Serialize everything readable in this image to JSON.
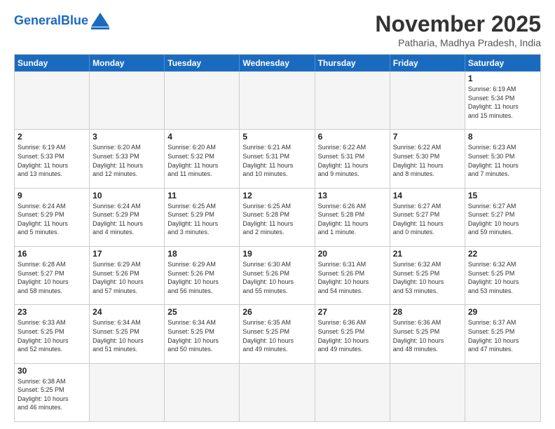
{
  "header": {
    "logo_general": "General",
    "logo_blue": "Blue",
    "month_title": "November 2025",
    "subtitle": "Patharia, Madhya Pradesh, India"
  },
  "day_names": [
    "Sunday",
    "Monday",
    "Tuesday",
    "Wednesday",
    "Thursday",
    "Friday",
    "Saturday"
  ],
  "weeks": [
    [
      {
        "date": "",
        "empty": true
      },
      {
        "date": "",
        "empty": true
      },
      {
        "date": "",
        "empty": true
      },
      {
        "date": "",
        "empty": true
      },
      {
        "date": "",
        "empty": true
      },
      {
        "date": "",
        "empty": true
      },
      {
        "date": "1",
        "info": "Sunrise: 6:19 AM\nSunset: 5:34 PM\nDaylight: 11 hours\nand 15 minutes."
      }
    ],
    [
      {
        "date": "2",
        "info": "Sunrise: 6:19 AM\nSunset: 5:33 PM\nDaylight: 11 hours\nand 13 minutes."
      },
      {
        "date": "3",
        "info": "Sunrise: 6:20 AM\nSunset: 5:33 PM\nDaylight: 11 hours\nand 12 minutes."
      },
      {
        "date": "4",
        "info": "Sunrise: 6:20 AM\nSunset: 5:32 PM\nDaylight: 11 hours\nand 11 minutes."
      },
      {
        "date": "5",
        "info": "Sunrise: 6:21 AM\nSunset: 5:31 PM\nDaylight: 11 hours\nand 10 minutes."
      },
      {
        "date": "6",
        "info": "Sunrise: 6:22 AM\nSunset: 5:31 PM\nDaylight: 11 hours\nand 9 minutes."
      },
      {
        "date": "7",
        "info": "Sunrise: 6:22 AM\nSunset: 5:30 PM\nDaylight: 11 hours\nand 8 minutes."
      },
      {
        "date": "8",
        "info": "Sunrise: 6:23 AM\nSunset: 5:30 PM\nDaylight: 11 hours\nand 7 minutes."
      }
    ],
    [
      {
        "date": "9",
        "info": "Sunrise: 6:24 AM\nSunset: 5:29 PM\nDaylight: 11 hours\nand 5 minutes."
      },
      {
        "date": "10",
        "info": "Sunrise: 6:24 AM\nSunset: 5:29 PM\nDaylight: 11 hours\nand 4 minutes."
      },
      {
        "date": "11",
        "info": "Sunrise: 6:25 AM\nSunset: 5:29 PM\nDaylight: 11 hours\nand 3 minutes."
      },
      {
        "date": "12",
        "info": "Sunrise: 6:25 AM\nSunset: 5:28 PM\nDaylight: 11 hours\nand 2 minutes."
      },
      {
        "date": "13",
        "info": "Sunrise: 6:26 AM\nSunset: 5:28 PM\nDaylight: 11 hours\nand 1 minute."
      },
      {
        "date": "14",
        "info": "Sunrise: 6:27 AM\nSunset: 5:27 PM\nDaylight: 11 hours\nand 0 minutes."
      },
      {
        "date": "15",
        "info": "Sunrise: 6:27 AM\nSunset: 5:27 PM\nDaylight: 10 hours\nand 59 minutes."
      }
    ],
    [
      {
        "date": "16",
        "info": "Sunrise: 6:28 AM\nSunset: 5:27 PM\nDaylight: 10 hours\nand 58 minutes."
      },
      {
        "date": "17",
        "info": "Sunrise: 6:29 AM\nSunset: 5:26 PM\nDaylight: 10 hours\nand 57 minutes."
      },
      {
        "date": "18",
        "info": "Sunrise: 6:29 AM\nSunset: 5:26 PM\nDaylight: 10 hours\nand 56 minutes."
      },
      {
        "date": "19",
        "info": "Sunrise: 6:30 AM\nSunset: 5:26 PM\nDaylight: 10 hours\nand 55 minutes."
      },
      {
        "date": "20",
        "info": "Sunrise: 6:31 AM\nSunset: 5:26 PM\nDaylight: 10 hours\nand 54 minutes."
      },
      {
        "date": "21",
        "info": "Sunrise: 6:32 AM\nSunset: 5:25 PM\nDaylight: 10 hours\nand 53 minutes."
      },
      {
        "date": "22",
        "info": "Sunrise: 6:32 AM\nSunset: 5:25 PM\nDaylight: 10 hours\nand 53 minutes."
      }
    ],
    [
      {
        "date": "23",
        "info": "Sunrise: 6:33 AM\nSunset: 5:25 PM\nDaylight: 10 hours\nand 52 minutes."
      },
      {
        "date": "24",
        "info": "Sunrise: 6:34 AM\nSunset: 5:25 PM\nDaylight: 10 hours\nand 51 minutes."
      },
      {
        "date": "25",
        "info": "Sunrise: 6:34 AM\nSunset: 5:25 PM\nDaylight: 10 hours\nand 50 minutes."
      },
      {
        "date": "26",
        "info": "Sunrise: 6:35 AM\nSunset: 5:25 PM\nDaylight: 10 hours\nand 49 minutes."
      },
      {
        "date": "27",
        "info": "Sunrise: 6:36 AM\nSunset: 5:25 PM\nDaylight: 10 hours\nand 49 minutes."
      },
      {
        "date": "28",
        "info": "Sunrise: 6:36 AM\nSunset: 5:25 PM\nDaylight: 10 hours\nand 48 minutes."
      },
      {
        "date": "29",
        "info": "Sunrise: 6:37 AM\nSunset: 5:25 PM\nDaylight: 10 hours\nand 47 minutes."
      }
    ],
    [
      {
        "date": "30",
        "info": "Sunrise: 6:38 AM\nSunset: 5:25 PM\nDaylight: 10 hours\nand 46 minutes."
      },
      {
        "date": "",
        "empty": true
      },
      {
        "date": "",
        "empty": true
      },
      {
        "date": "",
        "empty": true
      },
      {
        "date": "",
        "empty": true
      },
      {
        "date": "",
        "empty": true
      },
      {
        "date": "",
        "empty": true
      }
    ]
  ]
}
